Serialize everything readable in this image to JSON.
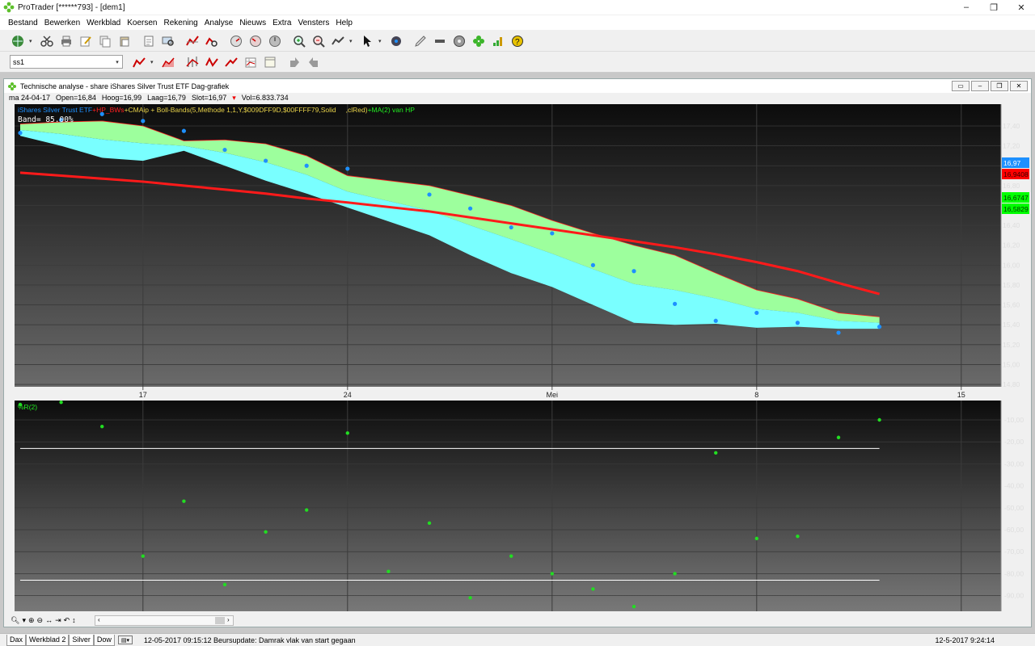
{
  "window": {
    "title": "ProTrader [******793] - [dem1]",
    "controls": [
      "–",
      "❐",
      "✕"
    ]
  },
  "menu": [
    "Bestand",
    "Bewerken",
    "Werkblad",
    "Koersen",
    "Rekening",
    "Analyse",
    "Nieuws",
    "Extra",
    "Vensters",
    "Help"
  ],
  "toolbar2": {
    "selector_value": "ss1"
  },
  "chart_window": {
    "title": "Technische analyse - share iShares Silver Trust ETF Dag-grafiek",
    "ohlc": {
      "date": "ma 24-04-17",
      "open": "Open=16,84",
      "high": "Hoog=16,99",
      "low": "Laag=16,79",
      "close": "Slot=16,97",
      "vol": "Vol=6.833.734"
    },
    "legend": {
      "instrument": "iShares Silver Trust ETF",
      "hp": "+HP_BWs",
      "indicator": "+CMAip + Boll-Bands(5,Methode 1,1,Y,$009DFF9D,$00FFFF79,Solid",
      "clred": ",clRed)",
      "ma": "+MA(2) van HP",
      "band": "Band= 85.00%"
    },
    "lower_label": "%R(2)",
    "side_labels": [
      {
        "text": "16,97",
        "bg": "#1e90ff",
        "fg": "#ffffff"
      },
      {
        "text": "16,9408",
        "bg": "#ff0000",
        "fg": "#330000"
      },
      {
        "text": "16,6747",
        "bg": "#00ff00",
        "fg": "#003300"
      },
      {
        "text": "16,5829",
        "bg": "#00ff00",
        "fg": "#003300"
      }
    ],
    "x_ticks": [
      "17",
      "24",
      "Mei",
      "8",
      "15"
    ],
    "price_ticks": [
      "17,40",
      "17,20",
      "17,00",
      "16,80",
      "16,60",
      "16,40",
      "16,20",
      "16,00",
      "15,80",
      "15,60",
      "15,40",
      "15,20",
      "15,00",
      "14,80"
    ],
    "r_ticks": [
      "-10,00",
      "-20,00",
      "-30,00",
      "-40,00",
      "-50,00",
      "-60,00",
      "-70,00",
      "-80,00",
      "-90,00"
    ]
  },
  "chart_data": [
    {
      "type": "scatter",
      "title": "Technische analyse - share iShares Silver Trust ETF Dag-grafiek",
      "ylim": [
        14.8,
        17.6
      ],
      "x": [
        1,
        2,
        3,
        4,
        5,
        6,
        7,
        8,
        9,
        11,
        12,
        13,
        14,
        15,
        16,
        17,
        18,
        19,
        20,
        21,
        22
      ],
      "x_tick_positions": {
        "17": 4,
        "24": 9,
        "Mei": 14,
        "8": 19,
        "15": 24
      },
      "series": [
        {
          "name": "iShares Silver Trust ETF",
          "color": "#1e90ff",
          "y": [
            17.33,
            17.46,
            17.52,
            17.45,
            17.35,
            17.16,
            17.05,
            17.0,
            16.97,
            16.71,
            16.57,
            16.38,
            16.32,
            16.0,
            15.94,
            15.61,
            15.44,
            15.52,
            15.42,
            15.32,
            15.38
          ]
        },
        {
          "name": "MA(2) van HP",
          "color": "#ff0000",
          "y": [
            16.93,
            16.9,
            16.87,
            16.84,
            16.8,
            16.76,
            16.72,
            16.67,
            16.63,
            16.54,
            16.48,
            16.42,
            16.36,
            16.3,
            16.24,
            16.18,
            16.11,
            16.03,
            15.94,
            15.82,
            15.71
          ]
        },
        {
          "name": "Boll-Bands upper",
          "color": "#9dff9d",
          "y": [
            17.42,
            17.44,
            17.45,
            17.4,
            17.25,
            17.26,
            17.22,
            17.1,
            16.9,
            16.8,
            16.7,
            16.6,
            16.45,
            16.32,
            16.2,
            16.1,
            15.92,
            15.75,
            15.66,
            15.52,
            15.48
          ]
        },
        {
          "name": "Boll-Bands lower",
          "color": "#79ffff",
          "y": [
            17.3,
            17.2,
            17.08,
            17.05,
            17.15,
            17.0,
            16.85,
            16.72,
            16.58,
            16.3,
            16.1,
            15.92,
            15.78,
            15.6,
            15.42,
            15.4,
            15.41,
            15.37,
            15.38,
            15.36,
            15.36
          ]
        }
      ]
    },
    {
      "type": "scatter",
      "title": "%R(2)",
      "ylim": [
        -95,
        0
      ],
      "reference_lines": [
        -23,
        -83
      ],
      "x": [
        1,
        2,
        3,
        4,
        5,
        6,
        7,
        8,
        9,
        10,
        11,
        12,
        13,
        14,
        15,
        16,
        17,
        18,
        19,
        20,
        21,
        22
      ],
      "series": [
        {
          "name": "%R(2)",
          "color": "#22dd22",
          "y": [
            -3,
            -2,
            -13,
            -72,
            -47,
            -85,
            -61,
            -51,
            -16,
            -79,
            -57,
            -91,
            -72,
            -80,
            -87,
            -95,
            -80,
            -25,
            -64,
            -63,
            -18,
            -10
          ]
        }
      ]
    }
  ],
  "nav_icons": [
    "search-icon",
    "zoom-in-icon",
    "zoom-out-icon",
    "fit-icon",
    "end-icon",
    "undo-icon",
    "scale-icon"
  ],
  "status": {
    "tabs": [
      "Dax",
      "Werkblad 2",
      "Silver",
      "Dow"
    ],
    "message": "12-05-2017 09:15:12 Beursupdate: Damrak vlak van start gegaan",
    "datetime": "12-5-2017 9:24:14"
  }
}
